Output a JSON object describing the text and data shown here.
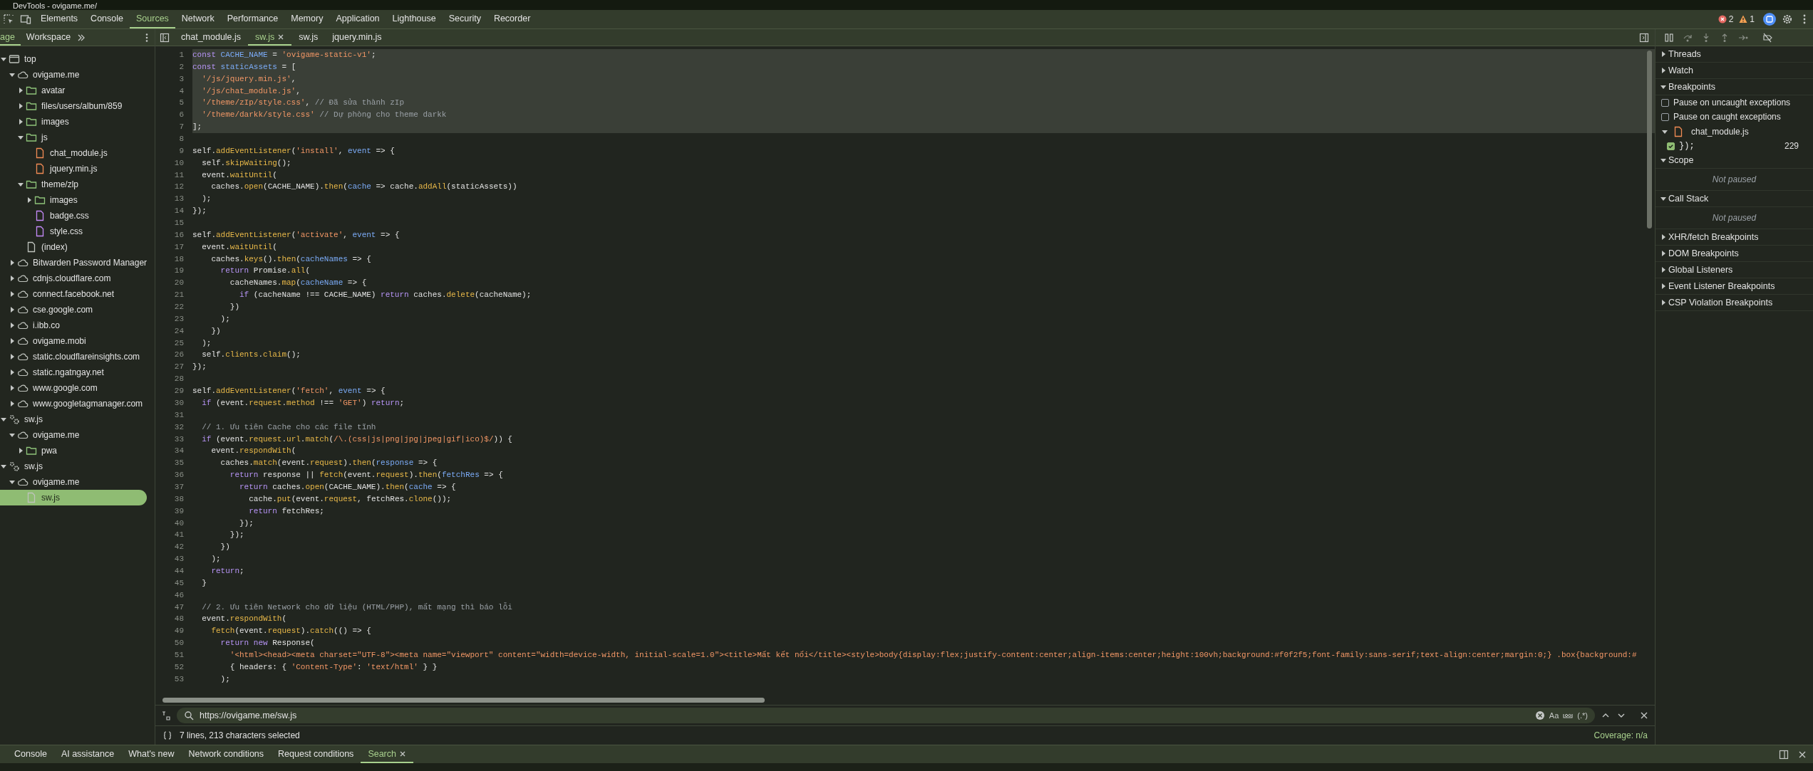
{
  "window": {
    "title": "DevTools - ovigame.me/"
  },
  "panel_tabs": [
    {
      "label": "Elements",
      "selected": false
    },
    {
      "label": "Console",
      "selected": false
    },
    {
      "label": "Sources",
      "selected": true
    },
    {
      "label": "Network",
      "selected": false
    },
    {
      "label": "Performance",
      "selected": false
    },
    {
      "label": "Memory",
      "selected": false
    },
    {
      "label": "Application",
      "selected": false
    },
    {
      "label": "Lighthouse",
      "selected": false
    },
    {
      "label": "Security",
      "selected": false
    },
    {
      "label": "Recorder",
      "selected": false
    }
  ],
  "issues": {
    "errors": "2",
    "warnings": "1"
  },
  "sidebar": {
    "tabs": [
      {
        "label": "age",
        "selected": true
      },
      {
        "label": "Workspace",
        "selected": false
      }
    ],
    "tree": [
      {
        "label": "top",
        "kind": "frame",
        "expanded": true,
        "selected": false,
        "children": [
          {
            "label": "ovigame.me",
            "kind": "domain",
            "expanded": true,
            "selected": false,
            "children": [
              {
                "label": "avatar",
                "kind": "folder",
                "expanded": false,
                "selected": false
              },
              {
                "label": "files/users/album/859",
                "kind": "folder",
                "expanded": false,
                "selected": false
              },
              {
                "label": "images",
                "kind": "folder",
                "expanded": false,
                "selected": false
              },
              {
                "label": "js",
                "kind": "folder",
                "expanded": true,
                "selected": false,
                "children": [
                  {
                    "label": "chat_module.js",
                    "kind": "script",
                    "selected": false
                  },
                  {
                    "label": "jquery.min.js",
                    "kind": "script",
                    "selected": false
                  }
                ]
              },
              {
                "label": "theme/zlp",
                "kind": "folder",
                "expanded": true,
                "selected": false,
                "children": [
                  {
                    "label": "images",
                    "kind": "folder",
                    "expanded": false,
                    "selected": false
                  },
                  {
                    "label": "badge.css",
                    "kind": "style",
                    "selected": false
                  },
                  {
                    "label": "style.css",
                    "kind": "style",
                    "selected": false
                  }
                ]
              },
              {
                "label": "(index)",
                "kind": "document",
                "selected": false
              }
            ]
          },
          {
            "label": "Bitwarden Password Manager",
            "kind": "domain",
            "expanded": false,
            "selected": false
          },
          {
            "label": "cdnjs.cloudflare.com",
            "kind": "domain",
            "expanded": false,
            "selected": false
          },
          {
            "label": "connect.facebook.net",
            "kind": "domain",
            "expanded": false,
            "selected": false
          },
          {
            "label": "cse.google.com",
            "kind": "domain",
            "expanded": false,
            "selected": false
          },
          {
            "label": "i.ibb.co",
            "kind": "domain",
            "expanded": false,
            "selected": false
          },
          {
            "label": "ovigame.mobi",
            "kind": "domain",
            "expanded": false,
            "selected": false
          },
          {
            "label": "static.cloudflareinsights.com",
            "kind": "domain",
            "expanded": false,
            "selected": false
          },
          {
            "label": "static.ngatngay.net",
            "kind": "domain",
            "expanded": false,
            "selected": false
          },
          {
            "label": "www.google.com",
            "kind": "domain",
            "expanded": false,
            "selected": false
          },
          {
            "label": "www.googletagmanager.com",
            "kind": "domain",
            "expanded": false,
            "selected": false
          }
        ]
      },
      {
        "label": "sw.js",
        "kind": "worker",
        "expanded": true,
        "selected": false,
        "children": [
          {
            "label": "ovigame.me",
            "kind": "domain",
            "expanded": true,
            "selected": false,
            "children": [
              {
                "label": "pwa",
                "kind": "folder",
                "expanded": false,
                "selected": false
              }
            ]
          }
        ]
      },
      {
        "label": "sw.js",
        "kind": "worker",
        "expanded": true,
        "selected": false,
        "children": [
          {
            "label": "ovigame.me",
            "kind": "domain",
            "expanded": true,
            "selected": false,
            "children": [
              {
                "label": "sw.js",
                "kind": "document",
                "selected": true
              }
            ]
          }
        ]
      }
    ]
  },
  "editor": {
    "tabs": [
      {
        "label": "chat_module.js",
        "selected": false,
        "closable": false
      },
      {
        "label": "sw.js",
        "selected": true,
        "closable": true
      },
      {
        "label": "sw.js",
        "selected": false,
        "closable": false
      },
      {
        "label": "jquery.min.js",
        "selected": false,
        "closable": false
      }
    ],
    "lines": [
      {
        "n": "1",
        "selected": true,
        "tokens": [
          {
            "kind": "k",
            "text": "const"
          },
          {
            "kind": "d",
            "text": " CACHE_NAME"
          },
          {
            "kind": "p",
            "text": " = "
          },
          {
            "kind": "s",
            "text": "'ovigame-static-v1'"
          },
          {
            "kind": "p",
            "text": ";"
          }
        ]
      },
      {
        "n": "2",
        "selected": true,
        "tokens": [
          {
            "kind": "k",
            "text": "const"
          },
          {
            "kind": "d",
            "text": " staticAssets"
          },
          {
            "kind": "p",
            "text": " = ["
          }
        ]
      },
      {
        "n": "3",
        "selected": true,
        "tokens": [
          {
            "kind": "s",
            "text": "  '/js/jquery.min.js'"
          },
          {
            "kind": "p",
            "text": ","
          }
        ]
      },
      {
        "n": "4",
        "selected": true,
        "tokens": [
          {
            "kind": "s",
            "text": "  '/js/chat_module.js'"
          },
          {
            "kind": "p",
            "text": ","
          }
        ]
      },
      {
        "n": "5",
        "selected": true,
        "tokens": [
          {
            "kind": "s",
            "text": "  '/theme/zIp/style.css'"
          },
          {
            "kind": "p",
            "text": ", "
          },
          {
            "kind": "c",
            "text": "// Đã sửa thành zIp"
          }
        ]
      },
      {
        "n": "6",
        "selected": true,
        "tokens": [
          {
            "kind": "s",
            "text": "  '/theme/darkk/style.css'"
          },
          {
            "kind": "c",
            "text": " // Dự phòng cho theme darkk"
          }
        ]
      },
      {
        "n": "7",
        "selected": true,
        "tokens": [
          {
            "kind": "p",
            "text": "];"
          }
        ]
      },
      {
        "n": "8",
        "selected": false
      },
      {
        "n": "9",
        "selected": false,
        "tokens": [
          {
            "kind": "p",
            "text": "self."
          },
          {
            "kind": "f",
            "text": "addEventListener"
          },
          {
            "kind": "p",
            "text": "("
          },
          {
            "kind": "s",
            "text": "'install'"
          },
          {
            "kind": "p",
            "text": ", "
          },
          {
            "kind": "d",
            "text": "event"
          },
          {
            "kind": "p",
            "text": " => {"
          }
        ]
      },
      {
        "n": "10",
        "selected": false,
        "tokens": [
          {
            "kind": "p",
            "text": "  self."
          },
          {
            "kind": "f",
            "text": "skipWaiting"
          },
          {
            "kind": "p",
            "text": "();"
          }
        ]
      },
      {
        "n": "11",
        "selected": false,
        "tokens": [
          {
            "kind": "p",
            "text": "  event."
          },
          {
            "kind": "f",
            "text": "waitUntil"
          },
          {
            "kind": "p",
            "text": "("
          }
        ]
      },
      {
        "n": "12",
        "selected": false,
        "tokens": [
          {
            "kind": "p",
            "text": "    caches."
          },
          {
            "kind": "f",
            "text": "open"
          },
          {
            "kind": "p",
            "text": "(CACHE_NAME)."
          },
          {
            "kind": "f",
            "text": "then"
          },
          {
            "kind": "p",
            "text": "("
          },
          {
            "kind": "d",
            "text": "cache"
          },
          {
            "kind": "p",
            "text": " => cache."
          },
          {
            "kind": "f",
            "text": "addAll"
          },
          {
            "kind": "p",
            "text": "(staticAssets))"
          }
        ]
      },
      {
        "n": "13",
        "selected": false,
        "tokens": [
          {
            "kind": "p",
            "text": "  );"
          }
        ]
      },
      {
        "n": "14",
        "selected": false,
        "tokens": [
          {
            "kind": "p",
            "text": "});"
          }
        ]
      },
      {
        "n": "15",
        "selected": false
      },
      {
        "n": "16",
        "selected": false,
        "tokens": [
          {
            "kind": "p",
            "text": "self."
          },
          {
            "kind": "f",
            "text": "addEventListener"
          },
          {
            "kind": "p",
            "text": "("
          },
          {
            "kind": "s",
            "text": "'activate'"
          },
          {
            "kind": "p",
            "text": ", "
          },
          {
            "kind": "d",
            "text": "event"
          },
          {
            "kind": "p",
            "text": " => {"
          }
        ]
      },
      {
        "n": "17",
        "selected": false,
        "tokens": [
          {
            "kind": "p",
            "text": "  event."
          },
          {
            "kind": "f",
            "text": "waitUntil"
          },
          {
            "kind": "p",
            "text": "("
          }
        ]
      },
      {
        "n": "18",
        "selected": false,
        "tokens": [
          {
            "kind": "p",
            "text": "    caches."
          },
          {
            "kind": "f",
            "text": "keys"
          },
          {
            "kind": "p",
            "text": "()."
          },
          {
            "kind": "f",
            "text": "then"
          },
          {
            "kind": "p",
            "text": "("
          },
          {
            "kind": "d",
            "text": "cacheNames"
          },
          {
            "kind": "p",
            "text": " => {"
          }
        ]
      },
      {
        "n": "19",
        "selected": false,
        "tokens": [
          {
            "kind": "k",
            "text": "      return"
          },
          {
            "kind": "p",
            "text": " Promise."
          },
          {
            "kind": "f",
            "text": "all"
          },
          {
            "kind": "p",
            "text": "("
          }
        ]
      },
      {
        "n": "20",
        "selected": false,
        "tokens": [
          {
            "kind": "p",
            "text": "        cacheNames."
          },
          {
            "kind": "f",
            "text": "map"
          },
          {
            "kind": "p",
            "text": "("
          },
          {
            "kind": "d",
            "text": "cacheName"
          },
          {
            "kind": "p",
            "text": " => {"
          }
        ]
      },
      {
        "n": "21",
        "selected": false,
        "tokens": [
          {
            "kind": "k",
            "text": "          if"
          },
          {
            "kind": "p",
            "text": " (cacheName !== CACHE_NAME) "
          },
          {
            "kind": "k",
            "text": "return"
          },
          {
            "kind": "p",
            "text": " caches."
          },
          {
            "kind": "f",
            "text": "delete"
          },
          {
            "kind": "p",
            "text": "(cacheName);"
          }
        ]
      },
      {
        "n": "22",
        "selected": false,
        "tokens": [
          {
            "kind": "p",
            "text": "        })"
          }
        ]
      },
      {
        "n": "23",
        "selected": false,
        "tokens": [
          {
            "kind": "p",
            "text": "      );"
          }
        ]
      },
      {
        "n": "24",
        "selected": false,
        "tokens": [
          {
            "kind": "p",
            "text": "    })"
          }
        ]
      },
      {
        "n": "25",
        "selected": false,
        "tokens": [
          {
            "kind": "p",
            "text": "  );"
          }
        ]
      },
      {
        "n": "26",
        "selected": false,
        "tokens": [
          {
            "kind": "p",
            "text": "  self."
          },
          {
            "kind": "f",
            "text": "clients"
          },
          {
            "kind": "p",
            "text": "."
          },
          {
            "kind": "f",
            "text": "claim"
          },
          {
            "kind": "p",
            "text": "();"
          }
        ]
      },
      {
        "n": "27",
        "selected": false,
        "tokens": [
          {
            "kind": "p",
            "text": "});"
          }
        ]
      },
      {
        "n": "28",
        "selected": false
      },
      {
        "n": "29",
        "selected": false,
        "tokens": [
          {
            "kind": "p",
            "text": "self."
          },
          {
            "kind": "f",
            "text": "addEventListener"
          },
          {
            "kind": "p",
            "text": "("
          },
          {
            "kind": "s",
            "text": "'fetch'"
          },
          {
            "kind": "p",
            "text": ", "
          },
          {
            "kind": "d",
            "text": "event"
          },
          {
            "kind": "p",
            "text": " => {"
          }
        ]
      },
      {
        "n": "30",
        "selected": false,
        "tokens": [
          {
            "kind": "k",
            "text": "  if"
          },
          {
            "kind": "p",
            "text": " (event."
          },
          {
            "kind": "f",
            "text": "request"
          },
          {
            "kind": "p",
            "text": "."
          },
          {
            "kind": "f",
            "text": "method"
          },
          {
            "kind": "p",
            "text": " !== "
          },
          {
            "kind": "s",
            "text": "'GET'"
          },
          {
            "kind": "p",
            "text": ") "
          },
          {
            "kind": "k",
            "text": "return"
          },
          {
            "kind": "p",
            "text": ";"
          }
        ]
      },
      {
        "n": "31",
        "selected": false
      },
      {
        "n": "32",
        "selected": false,
        "tokens": [
          {
            "kind": "c",
            "text": "  // 1. Ưu tiên Cache cho các file tĩnh"
          }
        ]
      },
      {
        "n": "33",
        "selected": false,
        "tokens": [
          {
            "kind": "k",
            "text": "  if"
          },
          {
            "kind": "p",
            "text": " (event."
          },
          {
            "kind": "f",
            "text": "request"
          },
          {
            "kind": "p",
            "text": "."
          },
          {
            "kind": "f",
            "text": "url"
          },
          {
            "kind": "p",
            "text": "."
          },
          {
            "kind": "f",
            "text": "match"
          },
          {
            "kind": "p",
            "text": "("
          },
          {
            "kind": "s",
            "text": "/\\.(css|js|png|jpg|jpeg|gif|ico)$/"
          },
          {
            "kind": "p",
            "text": ")) {"
          }
        ]
      },
      {
        "n": "34",
        "selected": false,
        "tokens": [
          {
            "kind": "p",
            "text": "    event."
          },
          {
            "kind": "f",
            "text": "respondWith"
          },
          {
            "kind": "p",
            "text": "("
          }
        ]
      },
      {
        "n": "35",
        "selected": false,
        "tokens": [
          {
            "kind": "p",
            "text": "      caches."
          },
          {
            "kind": "f",
            "text": "match"
          },
          {
            "kind": "p",
            "text": "(event."
          },
          {
            "kind": "f",
            "text": "request"
          },
          {
            "kind": "p",
            "text": ")."
          },
          {
            "kind": "f",
            "text": "then"
          },
          {
            "kind": "p",
            "text": "("
          },
          {
            "kind": "d",
            "text": "response"
          },
          {
            "kind": "p",
            "text": " => {"
          }
        ]
      },
      {
        "n": "36",
        "selected": false,
        "tokens": [
          {
            "kind": "k",
            "text": "        return"
          },
          {
            "kind": "p",
            "text": " response || "
          },
          {
            "kind": "f",
            "text": "fetch"
          },
          {
            "kind": "p",
            "text": "(event."
          },
          {
            "kind": "f",
            "text": "request"
          },
          {
            "kind": "p",
            "text": ")."
          },
          {
            "kind": "f",
            "text": "then"
          },
          {
            "kind": "p",
            "text": "("
          },
          {
            "kind": "d",
            "text": "fetchRes"
          },
          {
            "kind": "p",
            "text": " => {"
          }
        ]
      },
      {
        "n": "37",
        "selected": false,
        "tokens": [
          {
            "kind": "k",
            "text": "          return"
          },
          {
            "kind": "p",
            "text": " caches."
          },
          {
            "kind": "f",
            "text": "open"
          },
          {
            "kind": "p",
            "text": "(CACHE_NAME)."
          },
          {
            "kind": "f",
            "text": "then"
          },
          {
            "kind": "p",
            "text": "("
          },
          {
            "kind": "d",
            "text": "cache"
          },
          {
            "kind": "p",
            "text": " => {"
          }
        ]
      },
      {
        "n": "38",
        "selected": false,
        "tokens": [
          {
            "kind": "p",
            "text": "            cache."
          },
          {
            "kind": "f",
            "text": "put"
          },
          {
            "kind": "p",
            "text": "(event."
          },
          {
            "kind": "f",
            "text": "request"
          },
          {
            "kind": "p",
            "text": ", fetchRes."
          },
          {
            "kind": "f",
            "text": "clone"
          },
          {
            "kind": "p",
            "text": "());"
          }
        ]
      },
      {
        "n": "39",
        "selected": false,
        "tokens": [
          {
            "kind": "k",
            "text": "            return"
          },
          {
            "kind": "p",
            "text": " fetchRes;"
          }
        ]
      },
      {
        "n": "40",
        "selected": false,
        "tokens": [
          {
            "kind": "p",
            "text": "          });"
          }
        ]
      },
      {
        "n": "41",
        "selected": false,
        "tokens": [
          {
            "kind": "p",
            "text": "        });"
          }
        ]
      },
      {
        "n": "42",
        "selected": false,
        "tokens": [
          {
            "kind": "p",
            "text": "      })"
          }
        ]
      },
      {
        "n": "43",
        "selected": false,
        "tokens": [
          {
            "kind": "p",
            "text": "    );"
          }
        ]
      },
      {
        "n": "44",
        "selected": false,
        "tokens": [
          {
            "kind": "k",
            "text": "    return"
          },
          {
            "kind": "p",
            "text": ";"
          }
        ]
      },
      {
        "n": "45",
        "selected": false,
        "tokens": [
          {
            "kind": "p",
            "text": "  }"
          }
        ]
      },
      {
        "n": "46",
        "selected": false
      },
      {
        "n": "47",
        "selected": false,
        "tokens": [
          {
            "kind": "c",
            "text": "  // 2. Ưu tiên Network cho dữ liệu (HTML/PHP), mất mạng thì báo lỗi"
          }
        ]
      },
      {
        "n": "48",
        "selected": false,
        "tokens": [
          {
            "kind": "p",
            "text": "  event."
          },
          {
            "kind": "f",
            "text": "respondWith"
          },
          {
            "kind": "p",
            "text": "("
          }
        ]
      },
      {
        "n": "49",
        "selected": false,
        "tokens": [
          {
            "kind": "f",
            "text": "    fetch"
          },
          {
            "kind": "p",
            "text": "(event."
          },
          {
            "kind": "f",
            "text": "request"
          },
          {
            "kind": "p",
            "text": ")."
          },
          {
            "kind": "f",
            "text": "catch"
          },
          {
            "kind": "p",
            "text": "(() => {"
          }
        ]
      },
      {
        "n": "50",
        "selected": false,
        "tokens": [
          {
            "kind": "k",
            "text": "      return new"
          },
          {
            "kind": "p",
            "text": " Response("
          }
        ]
      },
      {
        "n": "51",
        "selected": false,
        "tokens": [
          {
            "kind": "s",
            "text": "        '<html><head><meta charset=\"UTF-8\"><meta name=\"viewport\" content=\"width=device-width, initial-scale=1.0\"><title>Mất kết nối</title><style>body{display:flex;justify-content:center;align-items:center;height:100vh;background:#f0f2f5;font-family:sans-serif;text-align:center;margin:0;} .box{background:#"
          }
        ]
      },
      {
        "n": "52",
        "selected": false,
        "tokens": [
          {
            "kind": "p",
            "text": "        { headers: { "
          },
          {
            "kind": "s",
            "text": "'Content-Type'"
          },
          {
            "kind": "p",
            "text": ": "
          },
          {
            "kind": "s",
            "text": "'text/html'"
          },
          {
            "kind": "p",
            "text": " } }"
          }
        ]
      },
      {
        "n": "53",
        "selected": false,
        "tokens": [
          {
            "kind": "p",
            "text": "      );"
          }
        ]
      }
    ]
  },
  "search_bar": {
    "value": "https://ovigame.me/sw.js",
    "toggles": [
      "Aa",
      "(.*)"
    ]
  },
  "status_bar": {
    "selection": "7 lines, 213 characters selected",
    "coverage": "Coverage: n/a"
  },
  "debugger": {
    "sections": [
      {
        "title": "Threads",
        "expanded": false
      },
      {
        "title": "Watch",
        "expanded": false
      },
      {
        "title": "Breakpoints",
        "expanded": true,
        "options": [
          {
            "label": "Pause on uncaught exceptions",
            "checked": false
          },
          {
            "label": "Pause on caught exceptions",
            "checked": false
          }
        ],
        "files": [
          {
            "name": "chat_module.js",
            "expanded": true,
            "breakpoints": [
              {
                "code": "});",
                "line": "229",
                "checked": true
              }
            ]
          }
        ]
      },
      {
        "title": "Scope",
        "expanded": true,
        "message": "Not paused"
      },
      {
        "title": "Call Stack",
        "expanded": true,
        "message": "Not paused"
      },
      {
        "title": "XHR/fetch Breakpoints",
        "expanded": false
      },
      {
        "title": "DOM Breakpoints",
        "expanded": false
      },
      {
        "title": "Global Listeners",
        "expanded": false
      },
      {
        "title": "Event Listener Breakpoints",
        "expanded": false
      },
      {
        "title": "CSP Violation Breakpoints",
        "expanded": false
      }
    ]
  },
  "drawer_tabs": [
    {
      "label": "Console",
      "selected": false,
      "closable": false
    },
    {
      "label": "AI assistance",
      "selected": false,
      "closable": false
    },
    {
      "label": "What's new",
      "selected": false,
      "closable": false
    },
    {
      "label": "Network conditions",
      "selected": false,
      "closable": false
    },
    {
      "label": "Request conditions",
      "selected": false,
      "closable": false
    },
    {
      "label": "Search",
      "selected": true,
      "closable": true
    }
  ]
}
